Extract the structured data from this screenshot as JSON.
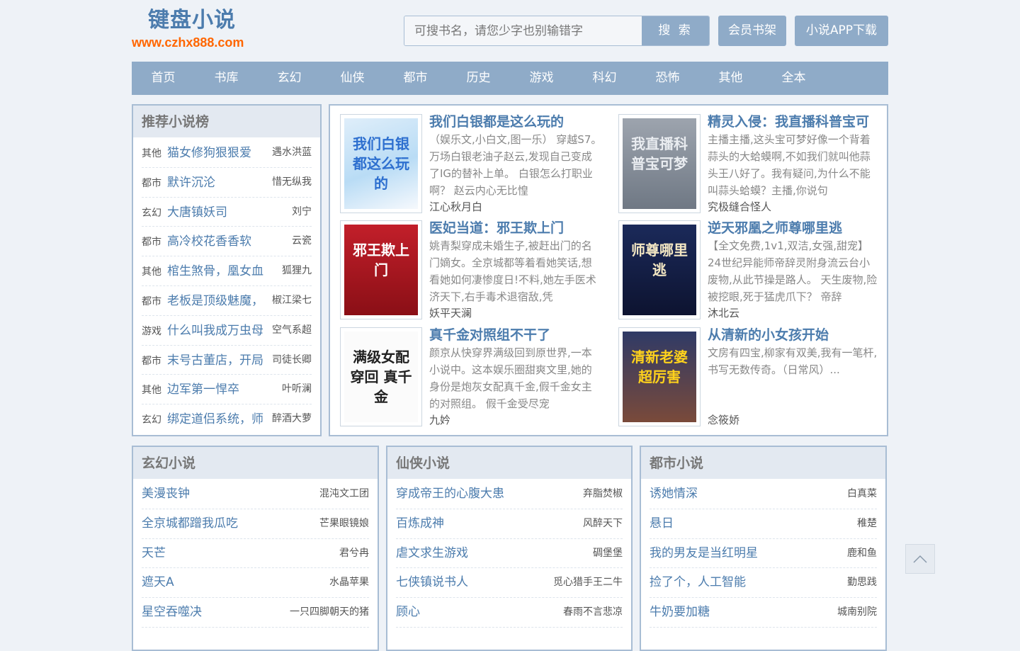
{
  "header": {
    "logo_title": "键盘小说",
    "logo_url": "www.czhx888.com",
    "search_placeholder": "可搜书名，请您少字也别输错字",
    "search_button": "搜 索",
    "bookshelf_button": "会员书架",
    "app_button": "小说APP下载"
  },
  "nav": [
    "首页",
    "书库",
    "玄幻",
    "仙侠",
    "都市",
    "历史",
    "游戏",
    "科幻",
    "恐怖",
    "其他",
    "全本"
  ],
  "ranking": {
    "title": "推荐小说榜",
    "items": [
      {
        "cat": "其他",
        "title": "猫女修狗狠狠爱",
        "author": "遇水洪蓝"
      },
      {
        "cat": "都市",
        "title": "默许沉沦",
        "author": "惜无纵我"
      },
      {
        "cat": "玄幻",
        "title": "大唐镇妖司",
        "author": "刘宁"
      },
      {
        "cat": "都市",
        "title": "高冷校花香香软",
        "author": "云瓷"
      },
      {
        "cat": "其他",
        "title": "棺生煞骨，凰女血",
        "author": "狐狸九"
      },
      {
        "cat": "都市",
        "title": "老板是顶级魅魔，",
        "author": "椒江梁七"
      },
      {
        "cat": "游戏",
        "title": "什么叫我成万虫母",
        "author": "空气系超"
      },
      {
        "cat": "都市",
        "title": "末号古董店，开局",
        "author": "司徒长卿"
      },
      {
        "cat": "其他",
        "title": "边军第一悍卒",
        "author": "叶听澜"
      },
      {
        "cat": "玄幻",
        "title": "绑定道侣系统，师",
        "author": "醉酒大萝"
      }
    ]
  },
  "featured": [
    {
      "title": "我们白银都是这么玩的",
      "desc": "（娱乐文,小白文,图一乐） 穿越S7。 万场白银老油子赵云,发现自己变成了IG的替补上单。 白银怎么打职业啊？ 赵云内心无比惶",
      "author": "江心秋月白",
      "cover_text": "我们白银都这么玩的"
    },
    {
      "title": "精灵入侵：我直播科普宝可",
      "desc": "主播主播,这头宝可梦好像一个背着蒜头的大蛤蟆啊,不如我们就叫他蒜头王八好了。我有疑问,为什么不能叫蒜头蛤蟆？主播,你说句",
      "author": "究极缝合怪人",
      "cover_text": "我直播科普宝可梦"
    },
    {
      "title": "医妃当道：邪王欺上门",
      "desc": "姚青梨穿成未婚生子,被赶出门的名门嫡女。全京城都等着看她笑话,想看她如何凄惨度日!不料,她左手医术济天下,右手毒术退宿敌,凭",
      "author": "妖平天澜",
      "cover_text": "邪王欺上门"
    },
    {
      "title": "逆天邪凰之师尊哪里逃",
      "desc": "【全文免费,1v1,双洁,女强,甜宠】24世纪异能师帝辞灵附身流云台小废物,从此节操是路人。 天生废物,险被挖眼,死于猛虎爪下？ 帝辞",
      "author": "沐北云",
      "cover_text": "师尊哪里逃"
    },
    {
      "title": "真千金对照组不干了",
      "desc": "颜京从快穿界满级回到原世界,一本小说中。这本娱乐圈甜爽文里,她的身份是炮灰女配真千金,假千金女主的对照组。 假千金受尽宠",
      "author": "九妗",
      "cover_text": "满级女配 穿回 真千金"
    },
    {
      "title": "从清新的小女孩开始",
      "desc": "文房有四宝,柳家有双美,我有一笔杆,书写无数传奇。（日常风）...",
      "author": "念筱娇",
      "cover_text": "清新老婆超厉害"
    }
  ],
  "sections": [
    {
      "title": "玄幻小说",
      "items": [
        {
          "title": "美漫丧钟",
          "author": "混沌文工团"
        },
        {
          "title": "全京城都蹭我瓜吃",
          "author": "芒果眼镜娘"
        },
        {
          "title": "天芒",
          "author": "君兮冉"
        },
        {
          "title": "遮天A",
          "author": "水晶苹果"
        },
        {
          "title": "星空吞噬决",
          "author": "一只四脚朝天的猪"
        }
      ]
    },
    {
      "title": "仙侠小说",
      "items": [
        {
          "title": "穿成帝王的心腹大患",
          "author": "弃脂焚椒"
        },
        {
          "title": "百炼成神",
          "author": "风醉天下"
        },
        {
          "title": "虐文求生游戏",
          "author": "碉堡堡"
        },
        {
          "title": "七侠镇说书人",
          "author": "觅心猎手王二牛"
        },
        {
          "title": "顾心",
          "author": "春雨不言悲凉"
        }
      ]
    },
    {
      "title": "都市小说",
      "items": [
        {
          "title": "诱她情深",
          "author": "白真菜"
        },
        {
          "title": "悬日",
          "author": "稚楚"
        },
        {
          "title": "我的男友是当红明星",
          "author": "鹿和鱼"
        },
        {
          "title": "捡了个，人工智能",
          "author": "勤思践"
        },
        {
          "title": "牛奶要加糖",
          "author": "城南别院"
        }
      ]
    }
  ]
}
